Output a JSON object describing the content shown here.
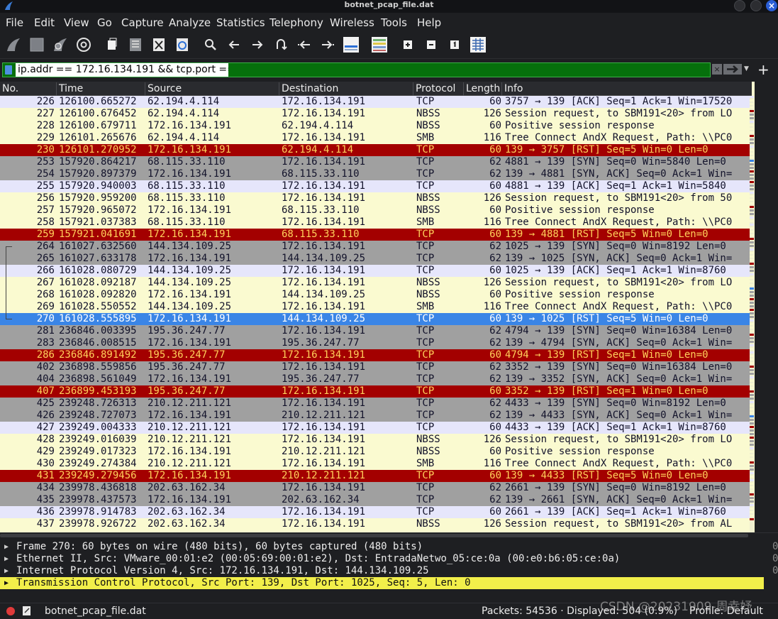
{
  "window": {
    "title": "botnet_pcap_file.dat"
  },
  "menu": [
    "File",
    "Edit",
    "View",
    "Go",
    "Capture",
    "Analyze",
    "Statistics",
    "Telephony",
    "Wireless",
    "Tools",
    "Help"
  ],
  "toolbar": {
    "icons": [
      "start-capture-icon",
      "stop-capture-icon",
      "restart-capture-icon",
      "capture-options-icon",
      "open-file-icon",
      "save-file-icon",
      "close-file-icon",
      "reload-file-icon",
      "find-packet-icon",
      "go-back-icon",
      "go-forward-icon",
      "go-to-packet-icon",
      "go-first-packet-icon",
      "go-last-packet-icon",
      "auto-scroll-icon",
      "colorize-icon",
      "zoom-in-icon",
      "zoom-out-icon",
      "normal-size-icon",
      "resize-columns-icon"
    ]
  },
  "filter": {
    "value": "ip.addr == 172.16.134.191 && tcp.port == 139"
  },
  "columns": [
    "No.",
    "Time",
    "Source",
    "Destination",
    "Protocol",
    "Length",
    "Info"
  ],
  "colors": {
    "tcp_ack_row": "#e6e6fb",
    "nbss_row": "#fafad0",
    "syn_row": "#a0a0a0",
    "rst_row": "#a30000",
    "rst_text": "#ffd05b",
    "selected_row": "#3a85e6",
    "filter_ok": "#06700c",
    "detail_highlight": "#f2ef4a"
  },
  "packets": [
    {
      "no": "226",
      "time": "126100.665272",
      "src": "62.194.4.114",
      "dst": "172.16.134.191",
      "proto": "TCP",
      "len": "60",
      "info": "3757 → 139 [ACK] Seq=1 Ack=1 Win=17520",
      "style": "tcp-ack"
    },
    {
      "no": "227",
      "time": "126100.676452",
      "src": "62.194.4.114",
      "dst": "172.16.134.191",
      "proto": "NBSS",
      "len": "126",
      "info": "Session request, to SBM191<20> from LO",
      "style": "nb"
    },
    {
      "no": "228",
      "time": "126100.679711",
      "src": "172.16.134.191",
      "dst": "62.194.4.114",
      "proto": "NBSS",
      "len": "60",
      "info": "Positive session response",
      "style": "nb"
    },
    {
      "no": "229",
      "time": "126101.265676",
      "src": "62.194.4.114",
      "dst": "172.16.134.191",
      "proto": "SMB",
      "len": "116",
      "info": "Tree Connect AndX Request, Path: \\\\PC0",
      "style": "nb"
    },
    {
      "no": "230",
      "time": "126101.270952",
      "src": "172.16.134.191",
      "dst": "62.194.4.114",
      "proto": "TCP",
      "len": "60",
      "info": "139 → 3757 [RST] Seq=5 Win=0 Len=0",
      "style": "rst"
    },
    {
      "no": "253",
      "time": "157920.864217",
      "src": "68.115.33.110",
      "dst": "172.16.134.191",
      "proto": "TCP",
      "len": "62",
      "info": "4881 → 139 [SYN] Seq=0 Win=5840 Len=0",
      "style": "syn"
    },
    {
      "no": "254",
      "time": "157920.897379",
      "src": "172.16.134.191",
      "dst": "68.115.33.110",
      "proto": "TCP",
      "len": "62",
      "info": "139 → 4881 [SYN, ACK] Seq=0 Ack=1 Win=",
      "style": "syn"
    },
    {
      "no": "255",
      "time": "157920.940003",
      "src": "68.115.33.110",
      "dst": "172.16.134.191",
      "proto": "TCP",
      "len": "60",
      "info": "4881 → 139 [ACK] Seq=1 Ack=1 Win=5840",
      "style": "tcp-ack"
    },
    {
      "no": "256",
      "time": "157920.959200",
      "src": "68.115.33.110",
      "dst": "172.16.134.191",
      "proto": "NBSS",
      "len": "126",
      "info": "Session request, to SBM191<20> from 50",
      "style": "nb"
    },
    {
      "no": "257",
      "time": "157920.965072",
      "src": "172.16.134.191",
      "dst": "68.115.33.110",
      "proto": "NBSS",
      "len": "60",
      "info": "Positive session response",
      "style": "nb"
    },
    {
      "no": "258",
      "time": "157921.037383",
      "src": "68.115.33.110",
      "dst": "172.16.134.191",
      "proto": "SMB",
      "len": "116",
      "info": "Tree Connect AndX Request, Path: \\\\PC0",
      "style": "nb"
    },
    {
      "no": "259",
      "time": "157921.041691",
      "src": "172.16.134.191",
      "dst": "68.115.33.110",
      "proto": "TCP",
      "len": "60",
      "info": "139 → 4881 [RST] Seq=5 Win=0 Len=0",
      "style": "rst"
    },
    {
      "no": "264",
      "time": "161027.632560",
      "src": "144.134.109.25",
      "dst": "172.16.134.191",
      "proto": "TCP",
      "len": "62",
      "info": "1025 → 139 [SYN] Seq=0 Win=8192 Len=0",
      "style": "syn"
    },
    {
      "no": "265",
      "time": "161027.633178",
      "src": "172.16.134.191",
      "dst": "144.134.109.25",
      "proto": "TCP",
      "len": "62",
      "info": "139 → 1025 [SYN, ACK] Seq=0 Ack=1 Win=",
      "style": "syn"
    },
    {
      "no": "266",
      "time": "161028.080729",
      "src": "144.134.109.25",
      "dst": "172.16.134.191",
      "proto": "TCP",
      "len": "60",
      "info": "1025 → 139 [ACK] Seq=1 Ack=1 Win=8760",
      "style": "tcp-ack"
    },
    {
      "no": "267",
      "time": "161028.092187",
      "src": "144.134.109.25",
      "dst": "172.16.134.191",
      "proto": "NBSS",
      "len": "126",
      "info": "Session request, to SBM191<20> from LO",
      "style": "nb"
    },
    {
      "no": "268",
      "time": "161028.092820",
      "src": "172.16.134.191",
      "dst": "144.134.109.25",
      "proto": "NBSS",
      "len": "60",
      "info": "Positive session response",
      "style": "nb"
    },
    {
      "no": "269",
      "time": "161028.550552",
      "src": "144.134.109.25",
      "dst": "172.16.134.191",
      "proto": "SMB",
      "len": "116",
      "info": "Tree Connect AndX Request, Path: \\\\PC0",
      "style": "nb"
    },
    {
      "no": "270",
      "time": "161028.555895",
      "src": "172.16.134.191",
      "dst": "144.134.109.25",
      "proto": "TCP",
      "len": "60",
      "info": "139 → 1025 [RST] Seq=5 Win=0 Len=0",
      "style": "sel"
    },
    {
      "no": "281",
      "time": "236846.003395",
      "src": "195.36.247.77",
      "dst": "172.16.134.191",
      "proto": "TCP",
      "len": "62",
      "info": "4794 → 139 [SYN] Seq=0 Win=16384 Len=0",
      "style": "syn"
    },
    {
      "no": "283",
      "time": "236846.008515",
      "src": "172.16.134.191",
      "dst": "195.36.247.77",
      "proto": "TCP",
      "len": "62",
      "info": "139 → 4794 [SYN, ACK] Seq=0 Ack=1 Win=",
      "style": "syn"
    },
    {
      "no": "286",
      "time": "236846.891492",
      "src": "195.36.247.77",
      "dst": "172.16.134.191",
      "proto": "TCP",
      "len": "60",
      "info": "4794 → 139 [RST] Seq=1 Win=0 Len=0",
      "style": "rst"
    },
    {
      "no": "402",
      "time": "236898.559856",
      "src": "195.36.247.77",
      "dst": "172.16.134.191",
      "proto": "TCP",
      "len": "62",
      "info": "3352 → 139 [SYN] Seq=0 Win=16384 Len=0",
      "style": "syn"
    },
    {
      "no": "404",
      "time": "236898.561049",
      "src": "172.16.134.191",
      "dst": "195.36.247.77",
      "proto": "TCP",
      "len": "62",
      "info": "139 → 3352 [SYN, ACK] Seq=0 Ack=1 Win=",
      "style": "syn"
    },
    {
      "no": "407",
      "time": "236899.453193",
      "src": "195.36.247.77",
      "dst": "172.16.134.191",
      "proto": "TCP",
      "len": "60",
      "info": "3352 → 139 [RST] Seq=1 Win=0 Len=0",
      "style": "rst"
    },
    {
      "no": "425",
      "time": "239248.726313",
      "src": "210.12.211.121",
      "dst": "172.16.134.191",
      "proto": "TCP",
      "len": "62",
      "info": "4433 → 139 [SYN] Seq=0 Win=8192 Len=0",
      "style": "syn"
    },
    {
      "no": "426",
      "time": "239248.727073",
      "src": "172.16.134.191",
      "dst": "210.12.211.121",
      "proto": "TCP",
      "len": "62",
      "info": "139 → 4433 [SYN, ACK] Seq=0 Ack=1 Win=",
      "style": "syn"
    },
    {
      "no": "427",
      "time": "239249.004333",
      "src": "210.12.211.121",
      "dst": "172.16.134.191",
      "proto": "TCP",
      "len": "60",
      "info": "4433 → 139 [ACK] Seq=1 Ack=1 Win=8760",
      "style": "tcp-ack"
    },
    {
      "no": "428",
      "time": "239249.016039",
      "src": "210.12.211.121",
      "dst": "172.16.134.191",
      "proto": "NBSS",
      "len": "126",
      "info": "Session request, to SBM191<20> from LO",
      "style": "nb"
    },
    {
      "no": "429",
      "time": "239249.017323",
      "src": "172.16.134.191",
      "dst": "210.12.211.121",
      "proto": "NBSS",
      "len": "60",
      "info": "Positive session response",
      "style": "nb"
    },
    {
      "no": "430",
      "time": "239249.274384",
      "src": "210.12.211.121",
      "dst": "172.16.134.191",
      "proto": "SMB",
      "len": "116",
      "info": "Tree Connect AndX Request, Path: \\\\PC0",
      "style": "nb"
    },
    {
      "no": "431",
      "time": "239249.279456",
      "src": "172.16.134.191",
      "dst": "210.12.211.121",
      "proto": "TCP",
      "len": "60",
      "info": "139 → 4433 [RST] Seq=5 Win=0 Len=0",
      "style": "rst"
    },
    {
      "no": "434",
      "time": "239978.436818",
      "src": "202.63.162.34",
      "dst": "172.16.134.191",
      "proto": "TCP",
      "len": "62",
      "info": "2661 → 139 [SYN] Seq=0 Win=8192 Len=0",
      "style": "syn"
    },
    {
      "no": "435",
      "time": "239978.437573",
      "src": "172.16.134.191",
      "dst": "202.63.162.34",
      "proto": "TCP",
      "len": "62",
      "info": "139 → 2661 [SYN, ACK] Seq=0 Ack=1 Win=",
      "style": "syn"
    },
    {
      "no": "436",
      "time": "239978.914783",
      "src": "202.63.162.34",
      "dst": "172.16.134.191",
      "proto": "TCP",
      "len": "60",
      "info": "2661 → 139 [ACK] Seq=1 Ack=1 Win=8760",
      "style": "tcp-ack"
    },
    {
      "no": "437",
      "time": "239978.926722",
      "src": "202.63.162.34",
      "dst": "172.16.134.191",
      "proto": "NBSS",
      "len": "126",
      "info": "Session request, to SBM191<20> from AL",
      "style": "nb"
    }
  ],
  "details": [
    {
      "text": "Frame 270: 60 bytes on wire (480 bits), 60 bytes captured (480 bits)",
      "highlight": false
    },
    {
      "text": "Ethernet II, Src: VMware_00:01:e2 (00:05:69:00:01:e2), Dst: EntradaNetwo_05:ce:0a (00:e0:b6:05:ce:0a)",
      "highlight": false
    },
    {
      "text": "Internet Protocol Version 4, Src: 172.16.134.191, Dst: 144.134.109.25",
      "highlight": false
    },
    {
      "text": "Transmission Control Protocol, Src Port: 139, Dst Port: 1025, Seq: 5, Len: 0",
      "highlight": true
    }
  ],
  "details_scroll_marks": [
    "0",
    "0",
    "0"
  ],
  "status": {
    "file": "botnet_pcap_file.dat",
    "packets": "Packets: 54536 · Displayed: 504 (0.9%)",
    "profile": "Profile: Default",
    "watermark": "CSDN @20231909-周幸妤"
  }
}
